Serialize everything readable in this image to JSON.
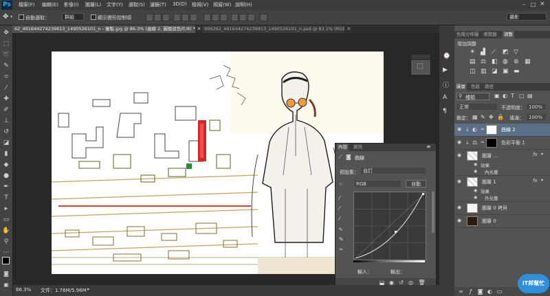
{
  "app": {
    "logo": "Ps"
  },
  "menu": [
    "檔案(F)",
    "編輯(E)",
    "影像(I)",
    "圖層(L)",
    "文字(Y)",
    "選取(S)",
    "濾鏡(T)",
    "3D(D)",
    "檢視(V)",
    "視窗(W)",
    "說明(H)"
  ],
  "options": {
    "auto_select_label": "自動選取：",
    "auto_select_value": "群組",
    "show_transform_label": "顯示變形控制項",
    "workspace": "攝影"
  },
  "tabs": [
    {
      "label": "62_491644274239813_1490526101_n - 複製.jpg @ 86.3% (曲線 2, 圖層遮色片/8) *",
      "close": "×",
      "active": true
    },
    {
      "label": "999262_491644274239813_1490526101_n.psd @ 83.1% (RGB/8) *",
      "close": "×",
      "active": false
    }
  ],
  "status": {
    "zoom": "86.3%",
    "doc_size": "文件：1.76M/5.96M"
  },
  "properties": {
    "tabs": [
      "內容",
      "資訊"
    ],
    "title": "曲線",
    "preset_label": "預設集：",
    "preset_value": "自訂",
    "channel": "RGB",
    "auto_button": "自動",
    "input_label": "輸入：",
    "output_label": "輸出："
  },
  "right_top_tabs": [
    "色階分佈圖",
    "導覽器",
    "調整"
  ],
  "adjust_title": "增加調整",
  "layers_panel": {
    "tabs": [
      "圖層",
      "色版",
      "路徑"
    ],
    "kind_filter": "種類",
    "blend_mode": "正常",
    "opacity_label": "不透明度：",
    "opacity_value": "100%",
    "lock_label": "鎖定：",
    "fill_label": "填滿：",
    "fill_value": "100%",
    "layers": [
      {
        "name": "曲線 2"
      },
      {
        "name": "色彩平衡 1"
      },
      {
        "name": "圖層 ...",
        "fx": "fx",
        "effect_label": "效果",
        "effect": "內光暈"
      },
      {
        "name": "圖層 1",
        "fx": "fx",
        "effect_label": "效果",
        "effect": "外光暈"
      },
      {
        "name": "圖層 0 拷貝"
      },
      {
        "name": "圖層 0"
      }
    ]
  },
  "watermark": {
    "text": "iT邦幫忙"
  }
}
